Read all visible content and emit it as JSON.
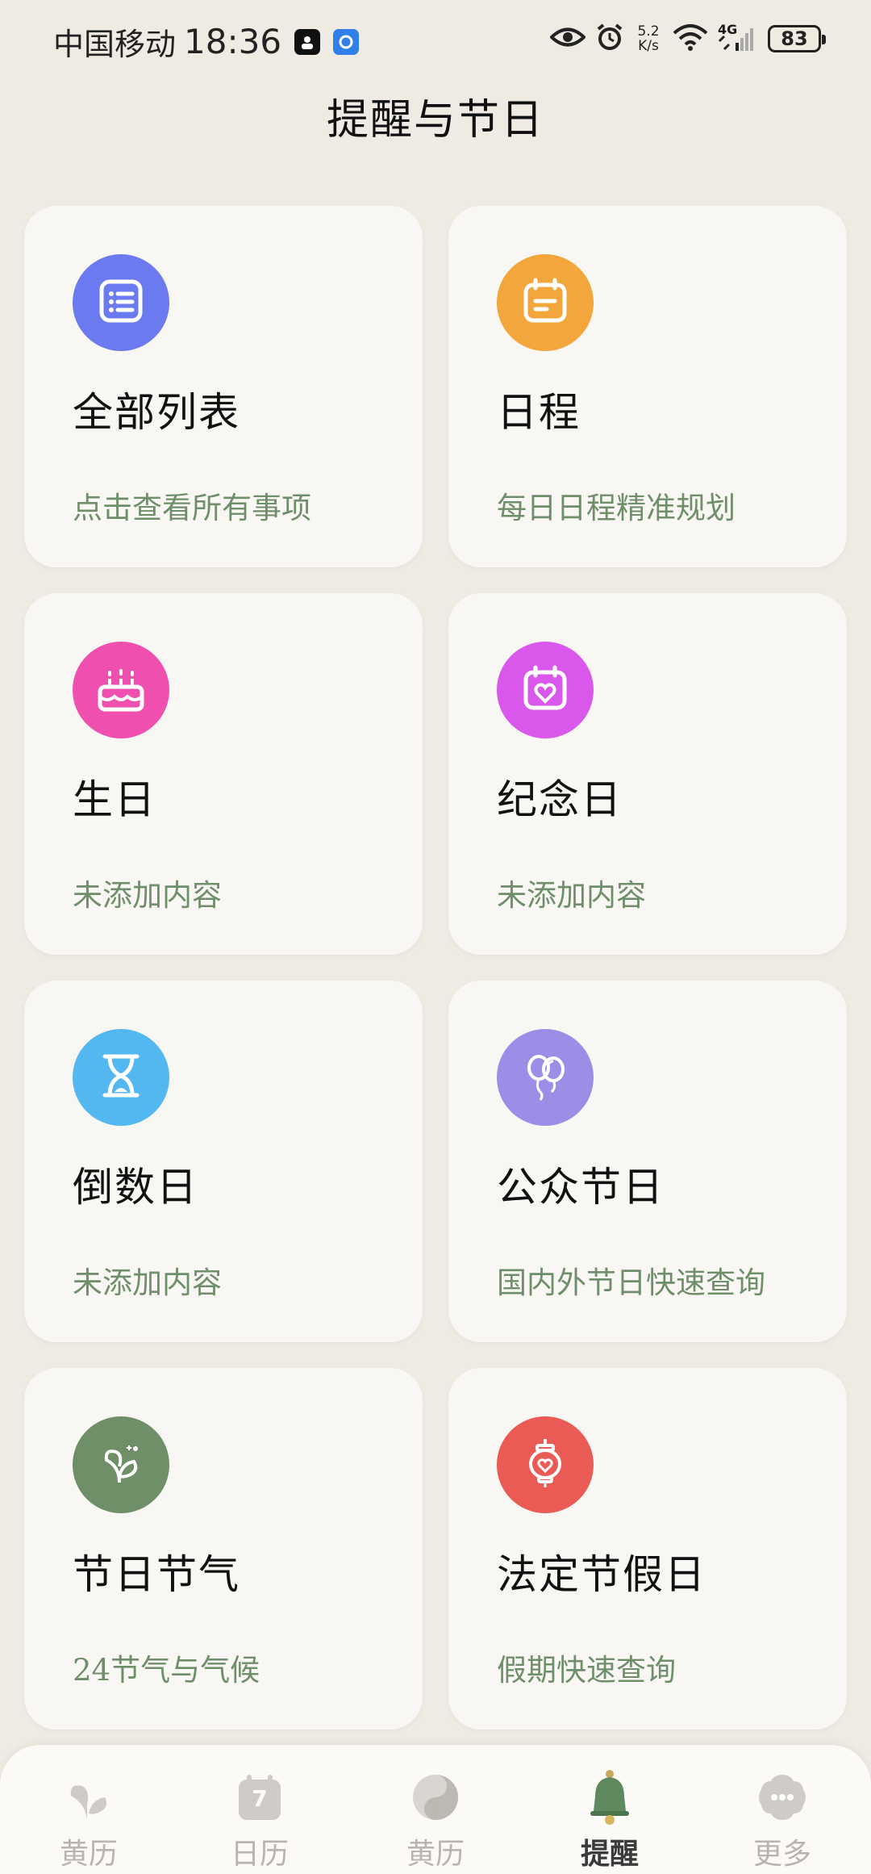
{
  "status_bar": {
    "carrier": "中国移动",
    "time": "18:36",
    "net_speed_value": "5.2",
    "net_speed_unit": "K/s",
    "network_type": "4G",
    "battery": "83"
  },
  "page": {
    "title": "提醒与节日"
  },
  "cards": [
    {
      "name": "全部列表",
      "desc": "点击查看所有事项",
      "icon": "list-icon",
      "color": "#6b7bef"
    },
    {
      "name": "日程",
      "desc": "每日日程精准规划",
      "icon": "calendar-icon",
      "color": "#f2a63b"
    },
    {
      "name": "生日",
      "desc": "未添加内容",
      "icon": "cake-icon",
      "color": "#ef4fae"
    },
    {
      "name": "纪念日",
      "desc": "未添加内容",
      "icon": "heart-calendar-icon",
      "color": "#d957ea"
    },
    {
      "name": "倒数日",
      "desc": "未添加内容",
      "icon": "hourglass-icon",
      "color": "#53b8ef"
    },
    {
      "name": "公众节日",
      "desc": "国内外节日快速查询",
      "icon": "balloons-icon",
      "color": "#9b8ee6"
    },
    {
      "name": "节日节气",
      "desc": "24节气与气候",
      "icon": "sprout-icon",
      "color": "#6e8f67"
    },
    {
      "name": "法定节假日",
      "desc": "假期快速查询",
      "icon": "lantern-icon",
      "color": "#ea5b55"
    }
  ],
  "bottom_nav": [
    {
      "label": "黄历",
      "icon": "sprout-nav-icon"
    },
    {
      "label": "日历",
      "icon": "calendar-nav-icon",
      "badge": "7"
    },
    {
      "label": "黄历",
      "icon": "yin-yang-icon"
    },
    {
      "label": "提醒",
      "icon": "bell-icon",
      "active": true
    },
    {
      "label": "更多",
      "icon": "more-icon"
    }
  ],
  "colors": {
    "background": "#efebe3",
    "card": "#f9f7f3",
    "desc_text": "#6f8e6a",
    "nav_active": "#5e8a5e",
    "nav_inactive": "#b8b5b0"
  }
}
